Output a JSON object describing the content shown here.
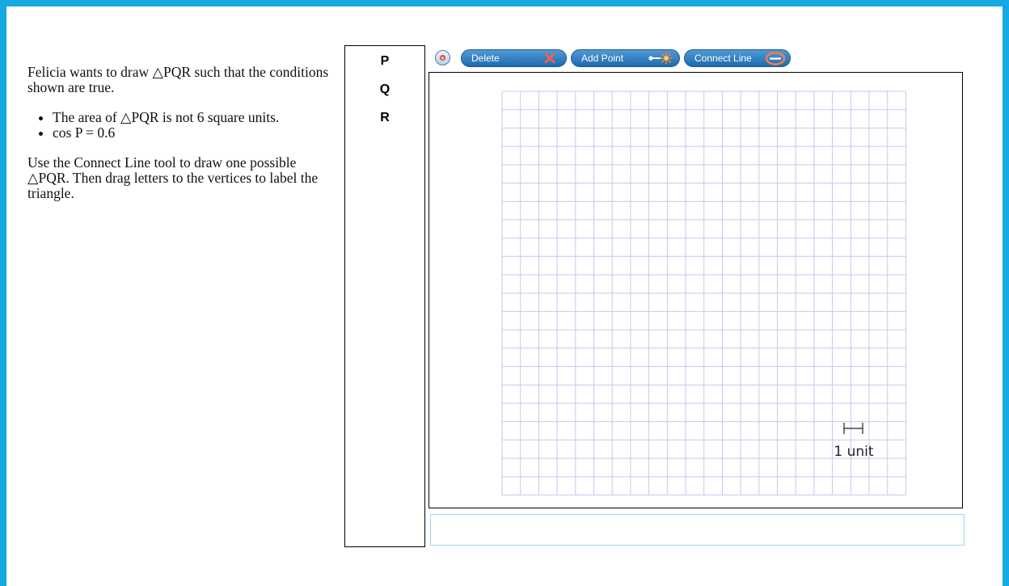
{
  "question": {
    "intro": "Felicia wants to draw △PQR such that the conditions shown are true.",
    "conditions": [
      "The area of △PQR is not 6 square units.",
      "cos P = 0.6"
    ],
    "instruction": "Use the Connect Line tool to draw one possible △PQR. Then drag letters to the vertices to label the triangle."
  },
  "labels": [
    "P",
    "Q",
    "R"
  ],
  "toolbar": {
    "pointer_icon": "pointer-icon",
    "delete_label": "Delete",
    "delete_icon": "x-icon",
    "add_point_label": "Add Point",
    "add_point_icon": "point-icon",
    "connect_line_label": "Connect Line",
    "connect_line_icon": "line-icon"
  },
  "grid": {
    "scale_label": "1 unit",
    "line_color": "#c9c6f2"
  },
  "colors": {
    "frame": "#14a9e2",
    "button": "#2f7fc1"
  }
}
